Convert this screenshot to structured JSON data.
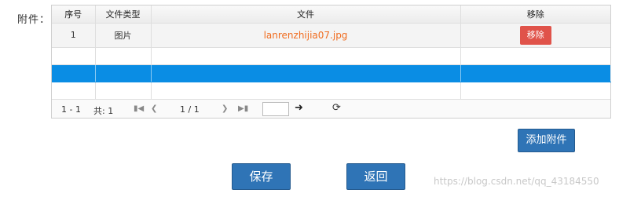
{
  "form": {
    "attachment_label": "附件："
  },
  "table": {
    "headers": [
      "序号",
      "文件类型",
      "文件",
      "移除"
    ],
    "rows": [
      {
        "index": "1",
        "type": "图片",
        "file": "lanrenzhijia07.jpg",
        "remove": "移除"
      }
    ]
  },
  "pager": {
    "range": "1 - 1",
    "total": "共: 1",
    "page_info": "1 / 1",
    "first_icon": "first-page-icon",
    "prev_icon": "prev-page-icon",
    "next_icon": "next-page-icon",
    "last_icon": "last-page-icon",
    "go_icon": "arrow-right-icon",
    "refresh_icon": "refresh-icon"
  },
  "buttons": {
    "add": "添加附件",
    "save": "保存",
    "back": "返回"
  },
  "watermark": "https://blog.csdn.net/qq_43184550",
  "colors": {
    "accent": "#2f74b6",
    "selected_row": "#0a8de4",
    "remove": "#e0534a",
    "link": "#f06c1f"
  }
}
